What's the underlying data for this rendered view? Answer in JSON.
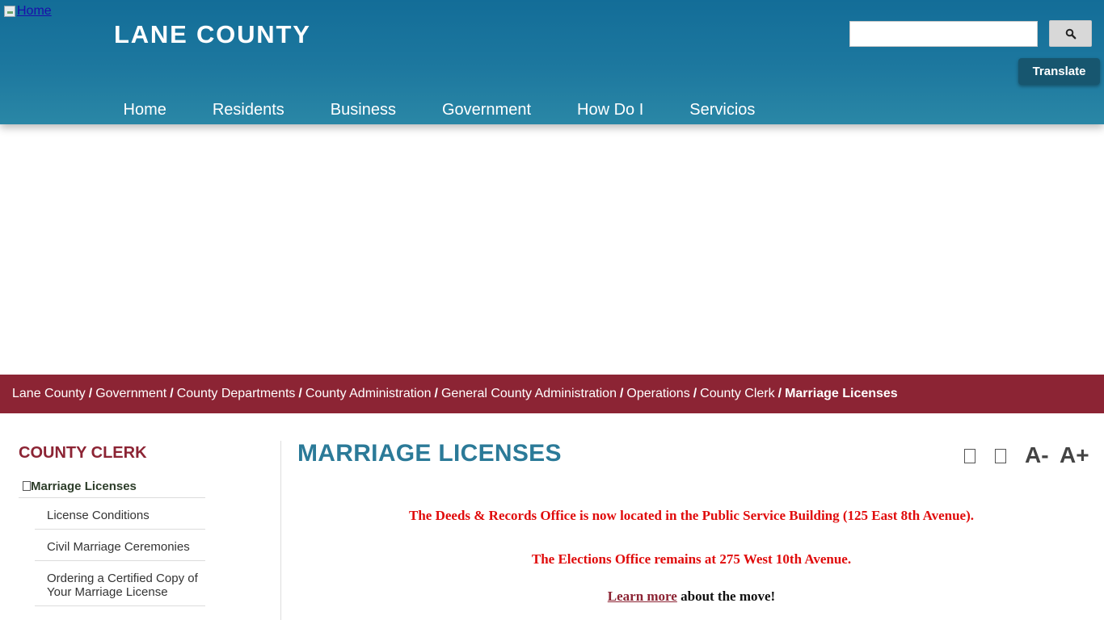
{
  "header": {
    "home_link": "Home",
    "site_title": "LANE COUNTY",
    "search": {
      "value": "",
      "placeholder": ""
    },
    "search_button_icon": "search-icon",
    "translate_label": "Translate"
  },
  "nav": {
    "items": [
      {
        "label": "Home"
      },
      {
        "label": "Residents"
      },
      {
        "label": "Business"
      },
      {
        "label": "Government"
      },
      {
        "label": "How Do I"
      },
      {
        "label": "Servicios"
      }
    ]
  },
  "breadcrumb": {
    "items": [
      {
        "label": "Lane County"
      },
      {
        "label": "Government"
      },
      {
        "label": "County Departments"
      },
      {
        "label": "County Administration"
      },
      {
        "label": "General County Administration"
      },
      {
        "label": "Operations"
      },
      {
        "label": "County Clerk"
      }
    ],
    "separator": "/",
    "current": "Marriage Licenses"
  },
  "sidebar": {
    "title": "COUNTY CLERK",
    "active_item": "Marriage Licenses",
    "sub_items": [
      {
        "label": "License Conditions"
      },
      {
        "label": "Civil Marriage Ceremonies"
      },
      {
        "label": "Ordering a Certified Copy of Your Marriage License"
      }
    ]
  },
  "main": {
    "title": "MARRIAGE LICENSES",
    "tools": {
      "decrease_font": "A-",
      "increase_font": "A+"
    },
    "notices": {
      "deeds": "The Deeds & Records Office is now located in the Public Service Building (125 East 8th Avenue).",
      "elections": "The Elections Office remains at 275 West 10th Avenue.",
      "learn_more_link": "Learn more",
      "learn_more_suffix": " about the move!"
    }
  },
  "colors": {
    "header_blue": "#136d98",
    "accent_maroon": "#8c2434",
    "title_teal": "#2b7a98",
    "notice_red": "#e00b0b"
  }
}
